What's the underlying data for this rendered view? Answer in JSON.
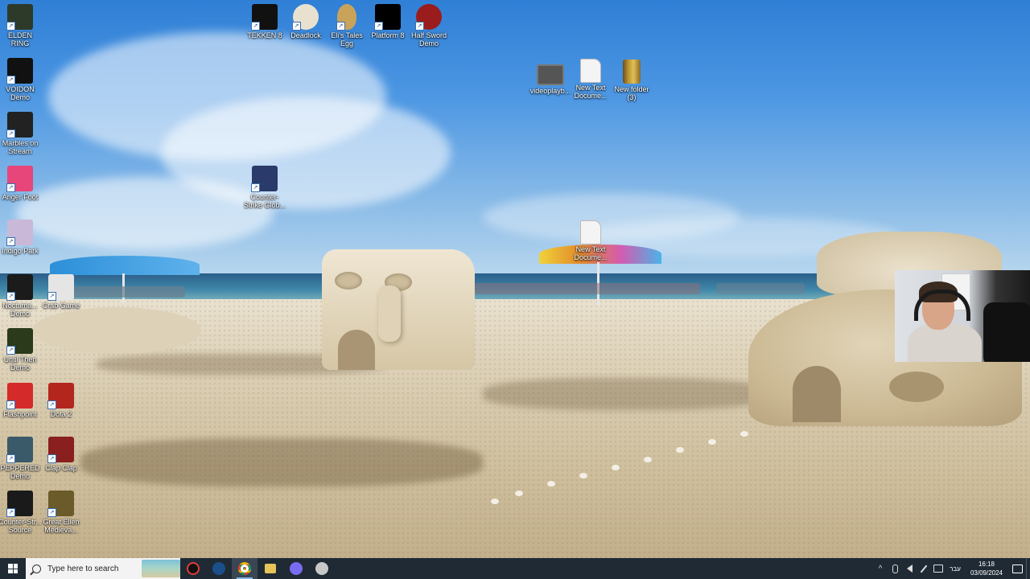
{
  "desktop": {
    "icons": [
      {
        "label": "ELDEN RING",
        "icon": "elden-ring-icon",
        "color": "#2d3a2a"
      },
      {
        "label": "VOIDON Demo",
        "icon": "voidon-crow-icon",
        "color": "#111111"
      },
      {
        "label": "Marbles on Stream",
        "icon": "marbles-icon",
        "color": "#222222"
      },
      {
        "label": "Anger Foot",
        "icon": "anger-foot-icon",
        "color": "#e6467a"
      },
      {
        "label": "Indigo Park",
        "icon": "indigo-park-icon",
        "color": "#c9b8d8"
      },
      {
        "label": "Noctuma... Demo",
        "icon": "nocturnal-icon",
        "color": "#1b1b1b"
      },
      {
        "label": "Crab Game",
        "icon": "crab-game-icon",
        "color": "#e5e5e5"
      },
      {
        "label": "Until Then Demo",
        "icon": "until-then-icon",
        "color": "#2a3a1a"
      },
      {
        "label": "Flashpoint",
        "icon": "flashpoint-icon",
        "color": "#d52a2a"
      },
      {
        "label": "Dota 2",
        "icon": "dota2-icon",
        "color": "#b3261e"
      },
      {
        "label": "PEPPERED Demo",
        "icon": "peppered-icon",
        "color": "#3a5a6a"
      },
      {
        "label": "Clap Clap",
        "icon": "clap-clap-icon",
        "color": "#8a1f1f"
      },
      {
        "label": "Counter-Str... Source",
        "icon": "counter-strike-source-icon",
        "color": "#1a1a1a"
      },
      {
        "label": "Great Ellen Medieva...",
        "icon": "great-ellen-icon",
        "color": "#6b5a2a"
      },
      {
        "label": "TEKKEN 8",
        "icon": "tekken8-icon",
        "color": "#111111"
      },
      {
        "label": "Deadlock",
        "icon": "deadlock-icon",
        "color": "#e9e1cf"
      },
      {
        "label": "Eli's Tales Egg",
        "icon": "egg-icon",
        "color": "#c9a35a"
      },
      {
        "label": "Platform 8",
        "icon": "platform8-icon",
        "color": "#000000"
      },
      {
        "label": "Half Sword Demo",
        "icon": "half-sword-icon",
        "color": "#9a1c1c"
      },
      {
        "label": "Counter-Strike Glob...",
        "icon": "csgo-icon",
        "color": "#2a3a6a"
      },
      {
        "label": "videoplayb...",
        "icon": "video-file-icon",
        "color": "#555555"
      },
      {
        "label": "New Text Docume...",
        "icon": "text-document-icon",
        "color": "#f4f4f4"
      },
      {
        "label": "New folder (3)",
        "icon": "folder-icon",
        "color": "#c9a13a"
      },
      {
        "label": "New Text Docume...",
        "icon": "text-document-icon",
        "color": "#f4f4f4"
      }
    ]
  },
  "taskbar": {
    "search_placeholder": "Type here to search",
    "apps": [
      {
        "name": "media-player-icon",
        "color": "#e23b3b"
      },
      {
        "name": "steam-icon",
        "color": "#1b4f8a"
      },
      {
        "name": "chrome-icon",
        "color": "#e9b82a"
      },
      {
        "name": "file-explorer-icon",
        "color": "#e6c45a"
      },
      {
        "name": "discord-icon",
        "color": "#7a6cf0"
      },
      {
        "name": "app-shield-icon",
        "color": "#c8c8c8"
      }
    ],
    "tray": {
      "chevron": "^",
      "language": "עבר",
      "time": "16:18",
      "date": "03/09/2024"
    }
  },
  "colors": {
    "taskbar_bg": "#1f2a35",
    "label_text": "#ffffff"
  }
}
